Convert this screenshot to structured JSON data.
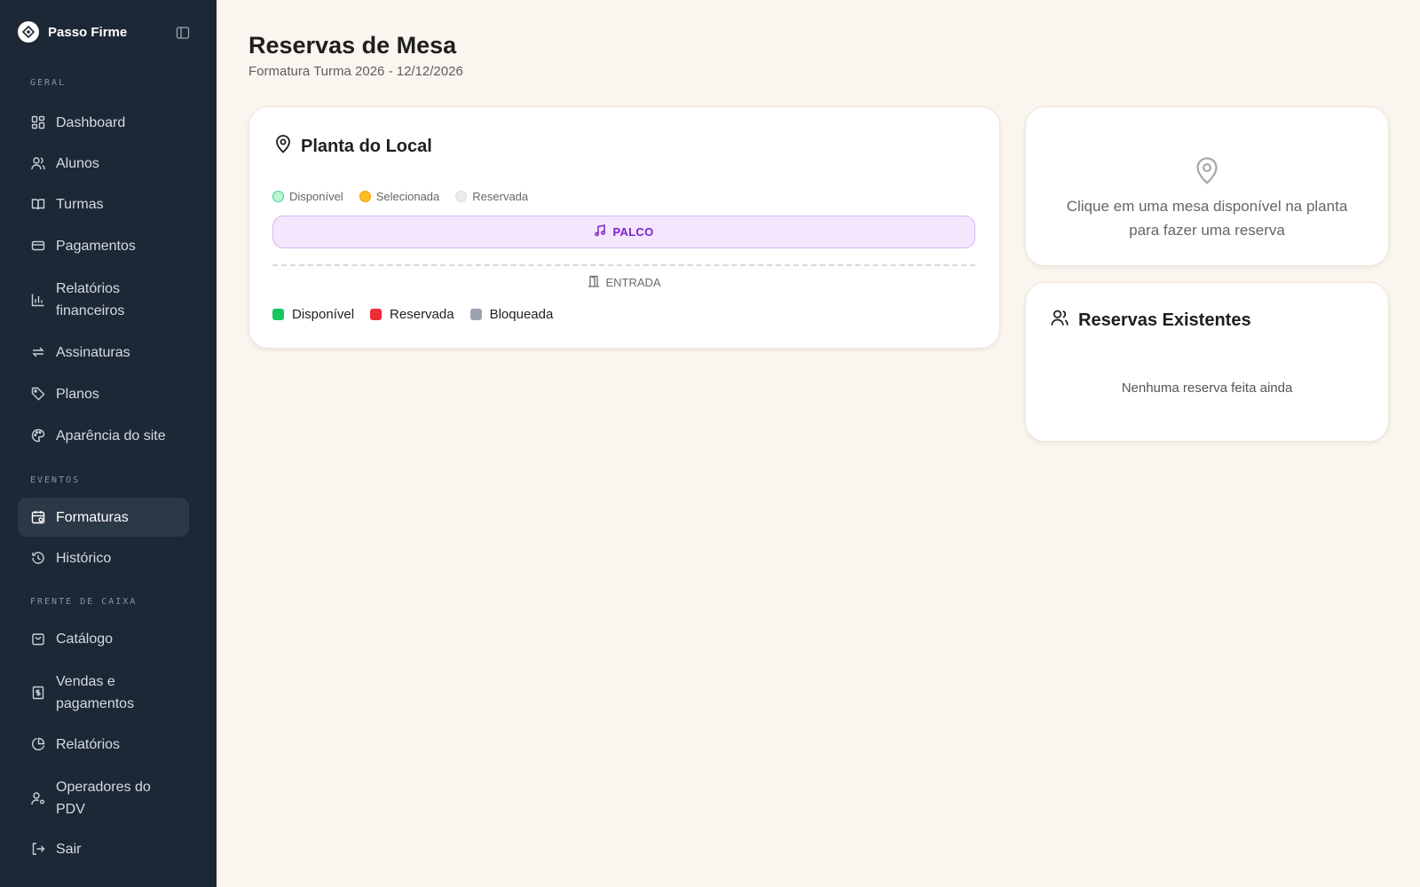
{
  "brand": {
    "name": "Passo Firme"
  },
  "sidebar": {
    "sections": [
      {
        "label": "GERAL"
      },
      {
        "label": "EVENTOS"
      },
      {
        "label": "FRENTE DE CAIXA"
      }
    ],
    "items": [
      {
        "label": "Dashboard",
        "icon": "dashboard-icon"
      },
      {
        "label": "Alunos",
        "icon": "users-icon"
      },
      {
        "label": "Turmas",
        "icon": "book-icon"
      },
      {
        "label": "Pagamentos",
        "icon": "card-icon"
      },
      {
        "label": "Relatórios financeiros",
        "icon": "bar-chart-icon"
      },
      {
        "label": "Assinaturas",
        "icon": "repeat-icon"
      },
      {
        "label": "Planos",
        "icon": "tag-icon"
      },
      {
        "label": "Aparência do site",
        "icon": "palette-icon"
      },
      {
        "label": "Formaturas",
        "icon": "calendar-icon",
        "active": true
      },
      {
        "label": "Histórico",
        "icon": "history-icon"
      },
      {
        "label": "Catálogo",
        "icon": "bag-icon"
      },
      {
        "label": "Vendas e pagamentos",
        "icon": "receipt-icon"
      },
      {
        "label": "Relatórios",
        "icon": "pie-chart-icon"
      },
      {
        "label": "Operadores do PDV",
        "icon": "user-cog-icon"
      },
      {
        "label": "Sair",
        "icon": "logout-icon"
      }
    ]
  },
  "page": {
    "title": "Reservas de Mesa",
    "subtitle": "Formatura Turma 2026 - 12/12/2026"
  },
  "floorplan": {
    "title": "Planta do Local",
    "legend_top": [
      {
        "label": "Disponível",
        "color": "#a7f3d0",
        "border": "#34d399"
      },
      {
        "label": "Selecionada",
        "color": "#fbbf24",
        "border": "#f59e0b"
      },
      {
        "label": "Reservada",
        "color": "#e5e7eb",
        "border": "#d1d5db"
      }
    ],
    "stage_label": "PALCO",
    "entrance_label": "ENTRADA",
    "legend_bottom": [
      {
        "label": "Disponível",
        "color": "#16c55e"
      },
      {
        "label": "Reservada",
        "color": "#ef2c3a"
      },
      {
        "label": "Bloqueada",
        "color": "#9ca3af"
      }
    ]
  },
  "reserve_hint": {
    "text": "Clique em uma mesa disponível na planta para fazer uma reserva"
  },
  "existing": {
    "title": "Reservas Existentes",
    "empty": "Nenhuma reserva feita ainda"
  }
}
